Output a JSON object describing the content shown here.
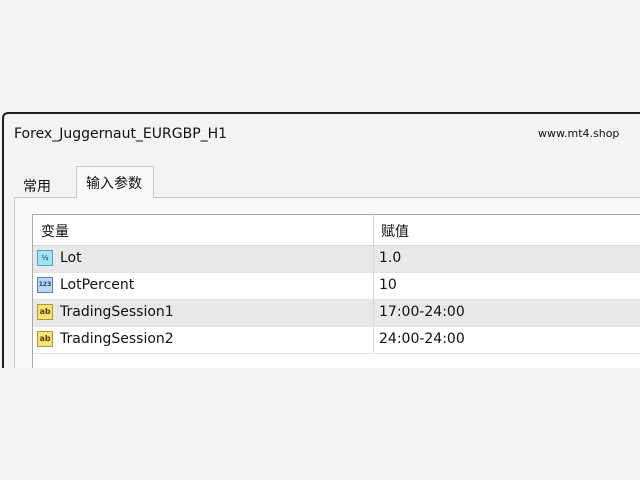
{
  "window": {
    "title": "Forex_Juggernaut_EURGBP_H1",
    "site": "www.mt4.shop"
  },
  "tabs": [
    {
      "label": "常用",
      "active": false
    },
    {
      "label": "输入参数",
      "active": true
    }
  ],
  "table": {
    "columns": [
      "变量",
      "赋值"
    ],
    "rows": [
      {
        "icon": "fraction-type-icon",
        "icon_text": "½",
        "name": "Lot",
        "value": "1.0"
      },
      {
        "icon": "integer-type-icon",
        "icon_text": "123",
        "name": "LotPercent",
        "value": "10"
      },
      {
        "icon": "string-type-icon",
        "icon_text": "ab",
        "name": "TradingSession1",
        "value": "17:00-24:00"
      },
      {
        "icon": "string-type-icon",
        "icon_text": "ab",
        "name": "TradingSession2",
        "value": "24:00-24:00"
      }
    ]
  }
}
